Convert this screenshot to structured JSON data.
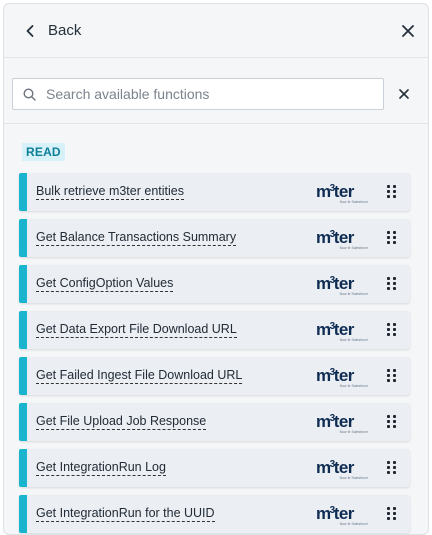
{
  "header": {
    "back_label": "Back"
  },
  "search": {
    "placeholder": "Search available functions",
    "value": ""
  },
  "section": {
    "label": "READ"
  },
  "brand": {
    "wordmark_pre": "m",
    "wordmark_sup": "3",
    "wordmark_post": "ter",
    "tagline": "Now ⊕ Salesforce"
  },
  "colors": {
    "accent": "#1ab4cf",
    "badge_bg": "#d6f1f7",
    "badge_text": "#0d7f99",
    "logo": "#0f2c53"
  },
  "icons": {
    "back": "chevron-left-icon",
    "close": "close-icon",
    "search": "search-icon",
    "clear": "close-icon",
    "drag": "drag-handle-icon"
  },
  "functions": [
    {
      "label": "Bulk retrieve m3ter entities"
    },
    {
      "label": "Get Balance Transactions Summary"
    },
    {
      "label": "Get ConfigOption Values"
    },
    {
      "label": "Get Data Export File Download URL"
    },
    {
      "label": "Get Failed Ingest File Download URL"
    },
    {
      "label": "Get File Upload Job Response"
    },
    {
      "label": "Get IntegrationRun Log"
    },
    {
      "label": "Get IntegrationRun for the UUID"
    }
  ]
}
